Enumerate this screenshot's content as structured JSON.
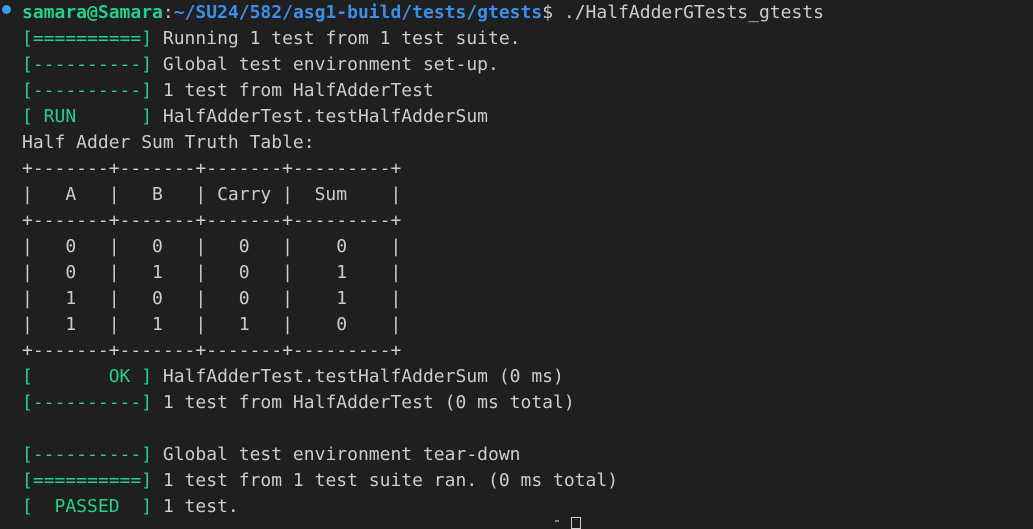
{
  "prompt": {
    "user_host": "samara@Samara",
    "separator": ":",
    "path": "~/SU24/582/asg1-build/tests/gtests",
    "symbol": "$",
    "command": " ./HalfAdderGTests_gtests"
  },
  "lines": [
    {
      "tag": "[==========]",
      "text": " Running 1 test from 1 test suite."
    },
    {
      "tag": "[----------]",
      "text": " Global test environment set-up."
    },
    {
      "tag": "[----------]",
      "text": " 1 test from HalfAdderTest"
    },
    {
      "tag": "[ RUN      ]",
      "text": " HalfAdderTest.testHalfAdderSum"
    },
    {
      "tag": "",
      "text": "Half Adder Sum Truth Table:"
    },
    {
      "tag": "",
      "text": "+-------+-------+-------+---------+"
    },
    {
      "tag": "",
      "text": "|   A   |   B   | Carry |  Sum    |"
    },
    {
      "tag": "",
      "text": "+-------+-------+-------+---------+"
    },
    {
      "tag": "",
      "text": "|   0   |   0   |   0   |    0    |"
    },
    {
      "tag": "",
      "text": "|   0   |   1   |   0   |    1    |"
    },
    {
      "tag": "",
      "text": "|   1   |   0   |   0   |    1    |"
    },
    {
      "tag": "",
      "text": "|   1   |   1   |   1   |    0    |"
    },
    {
      "tag": "",
      "text": "+-------+-------+-------+---------+"
    },
    {
      "tag": "[       OK ]",
      "text": " HalfAdderTest.testHalfAdderSum (0 ms)"
    },
    {
      "tag": "[----------]",
      "text": " 1 test from HalfAdderTest (0 ms total)"
    },
    {
      "tag": "",
      "text": ""
    },
    {
      "tag": "[----------]",
      "text": " Global test environment tear-down"
    },
    {
      "tag": "[==========]",
      "text": " 1 test from 1 test suite ran. (0 ms total)"
    },
    {
      "tag": "[  PASSED  ]",
      "text": " 1 test."
    }
  ]
}
